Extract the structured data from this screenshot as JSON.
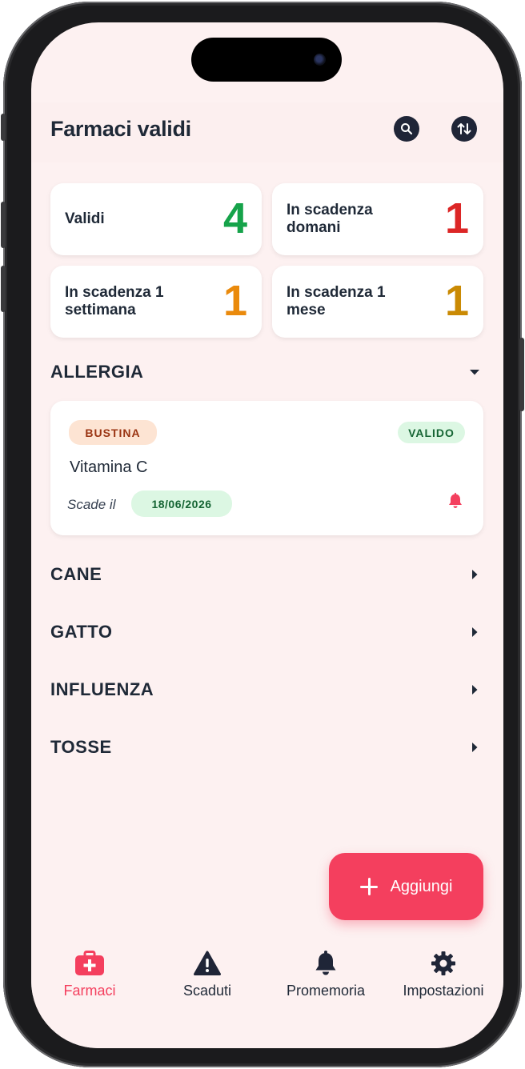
{
  "header": {
    "title": "Farmaci validi"
  },
  "stats": [
    {
      "label": "Validi",
      "value": "4",
      "color": "#16a34a"
    },
    {
      "label": "In scadenza domani",
      "value": "1",
      "color": "#dc2626"
    },
    {
      "label": "In scadenza 1 settimana",
      "value": "1",
      "color": "#ea8a0c"
    },
    {
      "label": "In scadenza 1 mese",
      "value": "1",
      "color": "#ca8a04"
    }
  ],
  "sections": [
    {
      "title": "ALLERGIA",
      "expanded": true
    },
    {
      "title": "CANE",
      "expanded": false
    },
    {
      "title": "GATTO",
      "expanded": false
    },
    {
      "title": "INFLUENZA",
      "expanded": false
    },
    {
      "title": "TOSSE",
      "expanded": false
    }
  ],
  "medicine": {
    "type": "BUSTINA",
    "status": "VALIDO",
    "name": "Vitamina C",
    "expires_label": "Scade il",
    "expires_date": "18/06/2026"
  },
  "fab": {
    "label": "Aggiungi"
  },
  "nav": [
    {
      "label": "Farmaci",
      "icon": "medkit-icon",
      "active": true
    },
    {
      "label": "Scaduti",
      "icon": "warning-icon",
      "active": false
    },
    {
      "label": "Promemoria",
      "icon": "bell-icon",
      "active": false
    },
    {
      "label": "Impostazioni",
      "icon": "gear-icon",
      "active": false
    }
  ],
  "colors": {
    "accent": "#f43f5e",
    "background": "#fdf1f1",
    "text": "#1f2937"
  }
}
